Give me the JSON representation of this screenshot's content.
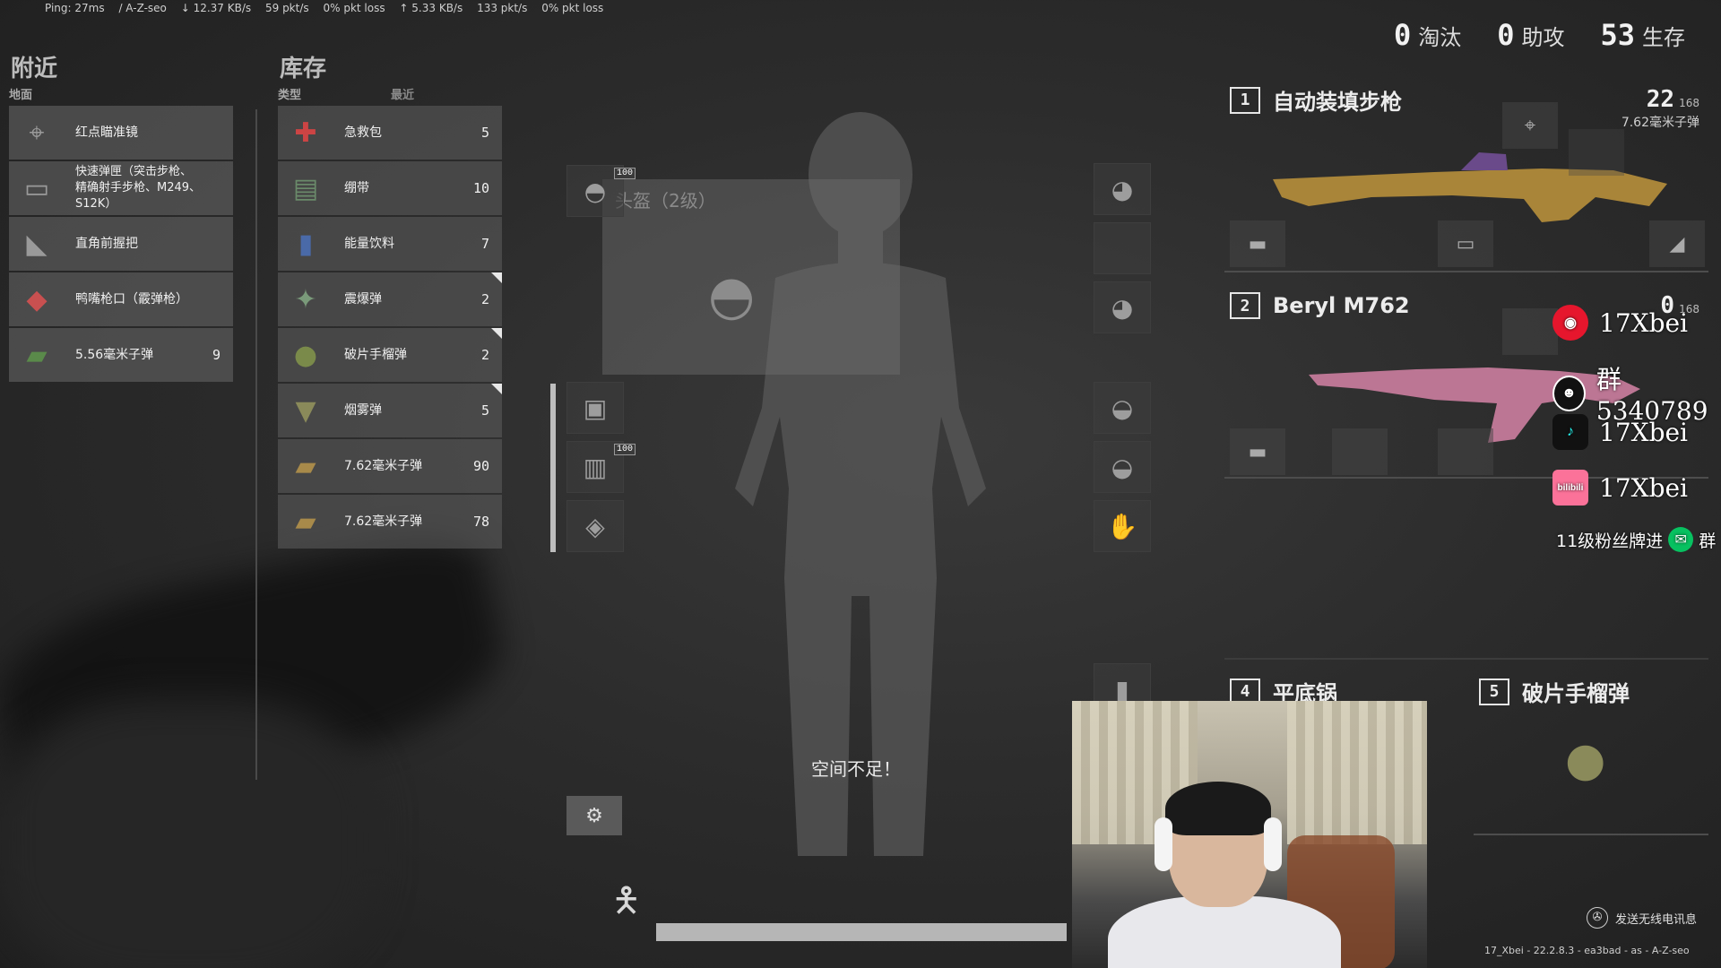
{
  "netbar": {
    "ping": "Ping: 27ms",
    "server": "/ A-Z-seo",
    "down_rate": "↓ 12.37 KB/s",
    "down_pkts": "59 pkt/s",
    "down_loss": "0% pkt loss",
    "up_rate": "↑ 5.33 KB/s",
    "up_pkts": "133 pkt/s",
    "up_loss": "0% pkt loss"
  },
  "scores": {
    "kills": "0",
    "kills_label": "淘汰",
    "assists": "0",
    "assists_label": "助攻",
    "alive": "53",
    "alive_label": "生存"
  },
  "nearby": {
    "title": "附近",
    "subtitle": "地面",
    "items": [
      {
        "name": "红点瞄准镜",
        "count": "",
        "icon": "red-dot-sight-icon"
      },
      {
        "name": "快速弹匣（突击步枪、精确射手步枪、M249、S12K）",
        "count": "",
        "icon": "quickdraw-mag-icon"
      },
      {
        "name": "直角前握把",
        "count": "",
        "icon": "angled-grip-icon"
      },
      {
        "name": "鸭嘴枪口（霰弹枪）",
        "count": "",
        "icon": "duckbill-icon"
      },
      {
        "name": "5.56毫米子弹",
        "count": "9",
        "icon": "ammo-556-icon"
      }
    ]
  },
  "inventory": {
    "title": "库存",
    "sort_type": "类型",
    "sort_recent": "最近",
    "items": [
      {
        "name": "急救包",
        "count": "5",
        "icon": "first-aid-icon",
        "flag": false
      },
      {
        "name": "绷带",
        "count": "10",
        "icon": "bandage-icon",
        "flag": false
      },
      {
        "name": "能量饮料",
        "count": "7",
        "icon": "energy-drink-icon",
        "flag": false
      },
      {
        "name": "震爆弹",
        "count": "2",
        "icon": "stun-grenade-icon",
        "flag": true
      },
      {
        "name": "破片手榴弹",
        "count": "2",
        "icon": "frag-grenade-icon",
        "flag": true
      },
      {
        "name": "烟雾弹",
        "count": "5",
        "icon": "smoke-grenade-icon",
        "flag": true
      },
      {
        "name": "7.62毫米子弹",
        "count": "90",
        "icon": "ammo-762-icon",
        "flag": false
      },
      {
        "name": "7.62毫米子弹",
        "count": "78",
        "icon": "ammo-762-icon",
        "flag": false
      }
    ]
  },
  "equipment": {
    "helmet_durability": "100",
    "helmet_tooltip": "头盔（2级）",
    "vest_durability": "100",
    "no_space_msg": "空间不足！"
  },
  "weapons": {
    "slot1": {
      "num": "1",
      "name": "自动装填步枪",
      "ammo": "22",
      "ammo_reserve": "168",
      "ammo_type": "7.62毫米子弹"
    },
    "slot2": {
      "num": "2",
      "name": "Beryl M762",
      "ammo": "0",
      "ammo_reserve": "168"
    },
    "slot4": {
      "num": "4",
      "name": "平底锅"
    },
    "slot5": {
      "num": "5",
      "name": "破片手榴弹"
    }
  },
  "overlay": {
    "weibo": "17Xbei",
    "qq_group": "群5340789",
    "douyin": "17Xbei",
    "bilibili": "17Xbei",
    "bilibili_logo": "bilibili",
    "fan_note": "11级粉丝牌进",
    "fan_note_suffix": "群"
  },
  "footer": {
    "radio_msg": "发送无线电讯息",
    "build_info": "17_Xbei - 22.2.8.3 - ea3bad - as - A-Z-seo"
  },
  "colors": {
    "panel_bg": "#5f5f5f",
    "accent_white": "#e6e6e6",
    "weibo": "#e6162d",
    "bilibili": "#fb7299",
    "wechat": "#07c160"
  }
}
